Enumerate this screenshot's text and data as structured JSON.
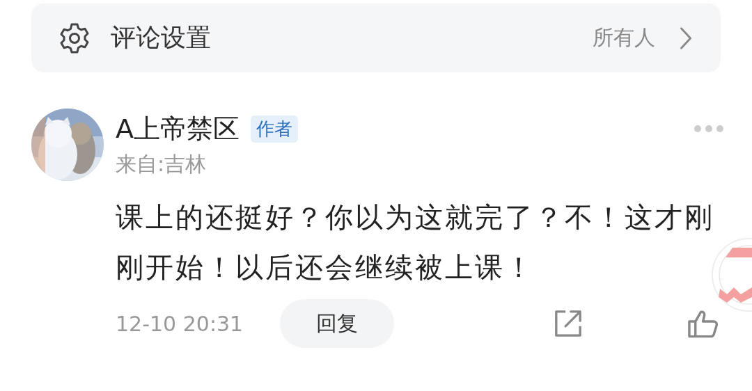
{
  "settings_bar": {
    "label": "评论设置",
    "value": "所有人"
  },
  "comment": {
    "author": "A上帝禁区",
    "badge": "作者",
    "location": "来自:吉林",
    "text": "课上的还挺好？你以为这就完了？不！这才刚刚开始！以后还会继续被上课！",
    "time": "12-10 20:31",
    "reply_button": "回复"
  }
}
